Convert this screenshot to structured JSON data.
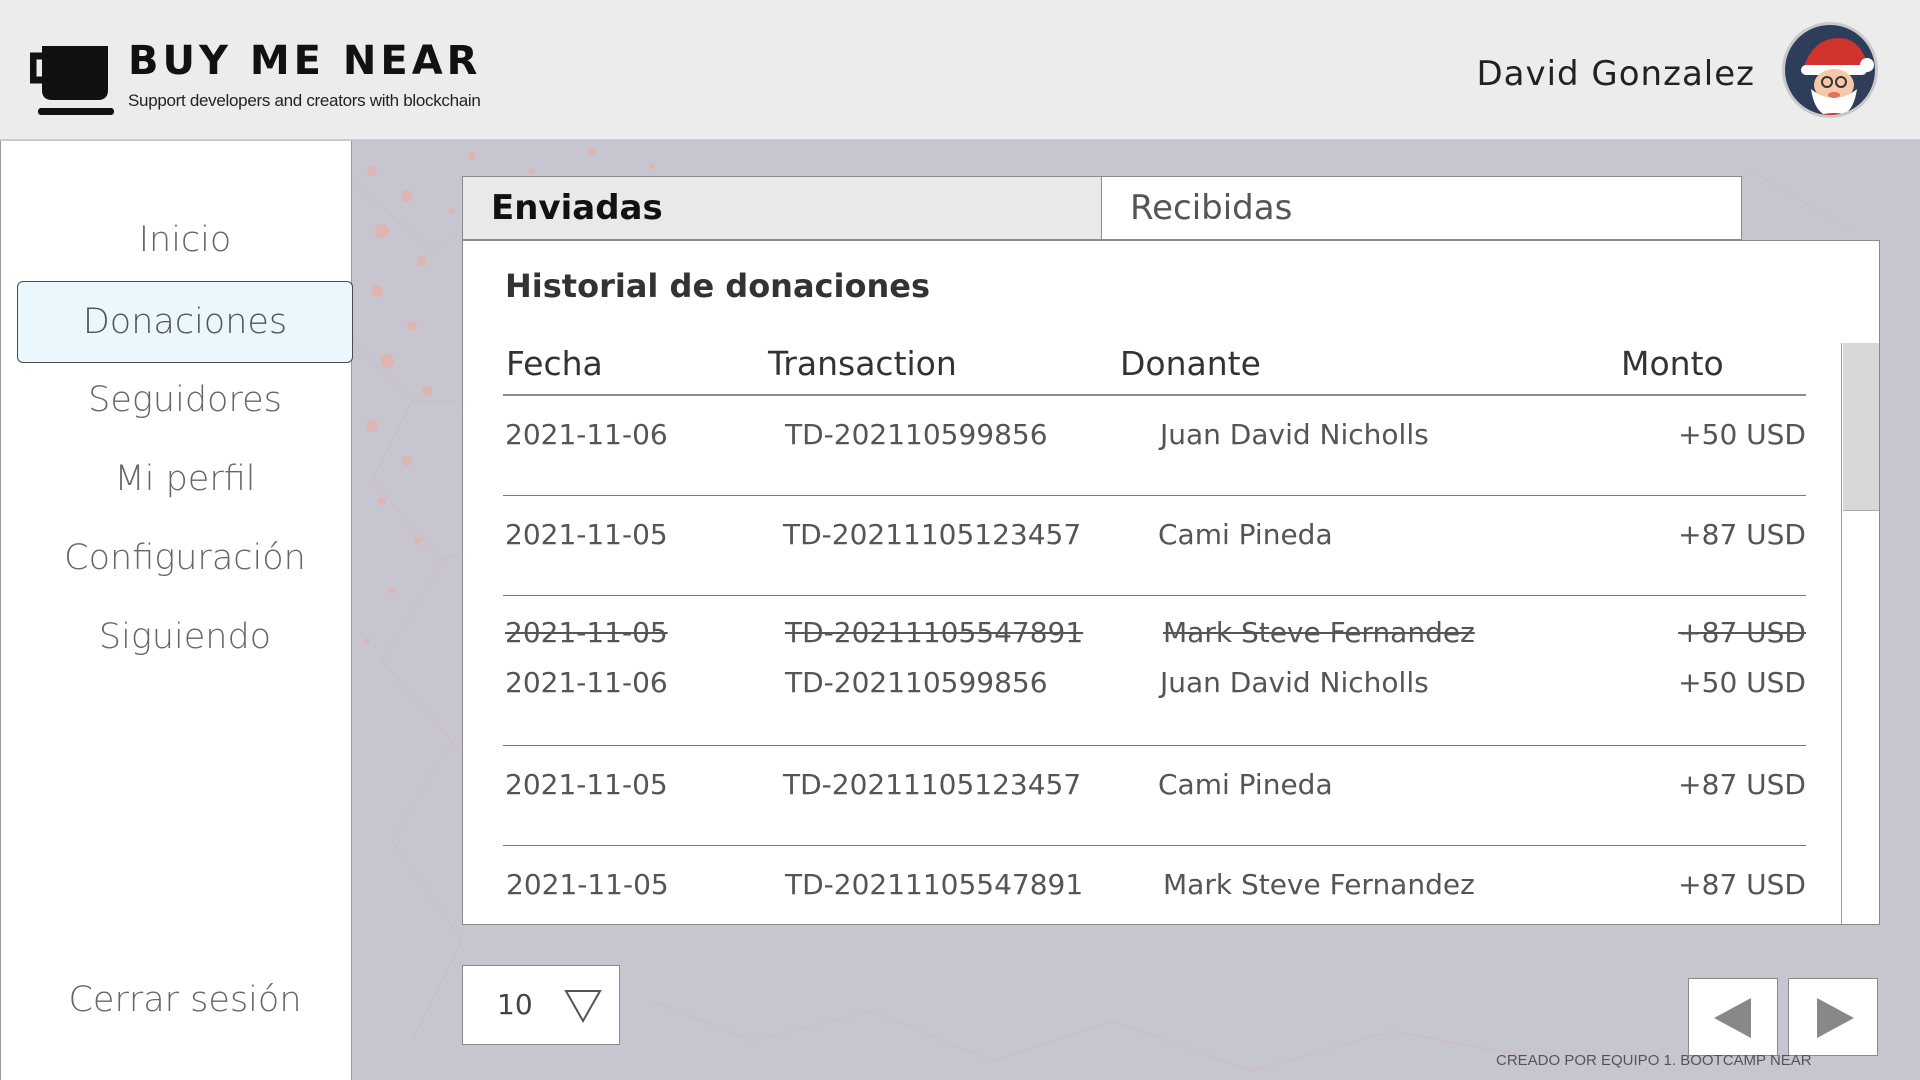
{
  "header": {
    "brand_title": "BUY ME NEAR",
    "brand_subtitle": "Support developers and creators with blockchain",
    "user_name": "David Gonzalez"
  },
  "sidebar": {
    "items": [
      {
        "label": "Inicio",
        "active": false
      },
      {
        "label": "Donaciones",
        "active": true
      },
      {
        "label": "Seguidores",
        "active": false
      },
      {
        "label": "Mi perfil",
        "active": false
      },
      {
        "label": "Configuración",
        "active": false
      },
      {
        "label": "Siguiendo",
        "active": false
      }
    ],
    "logout_label": "Cerrar sesión"
  },
  "tabs": [
    {
      "label": "Enviadas",
      "selected": true
    },
    {
      "label": "Recibidas",
      "selected": false
    }
  ],
  "panel": {
    "title": "Historial de donaciones",
    "columns": [
      "Fecha",
      "Transaction",
      "Donante",
      "Monto"
    ],
    "rows": [
      {
        "fecha": "2021-11-06",
        "transaction": "TD-202110599856",
        "donante": "Juan David Nicholls",
        "monto": "+50 USD"
      },
      {
        "fecha": "2021-11-05",
        "transaction": "TD-20211105123457",
        "donante": "Cami Pineda",
        "monto": "+87 USD"
      },
      {
        "fecha": "2021-11-05",
        "transaction": "TD-20211105547891",
        "donante": "Mark Steve Fernandez",
        "monto": "+87 USD"
      },
      {
        "fecha": "2021-11-06",
        "transaction": "TD-202110599856",
        "donante": "Juan David Nicholls",
        "monto": "+50 USD"
      },
      {
        "fecha": "2021-11-05",
        "transaction": "TD-20211105123457",
        "donante": "Cami Pineda",
        "monto": "+87 USD"
      },
      {
        "fecha": "2021-11-05",
        "transaction": "TD-20211105547891",
        "donante": "Mark Steve Fernandez",
        "monto": "+87 USD"
      }
    ]
  },
  "pagination": {
    "page_size": "10"
  },
  "footer": {
    "credit": "CREADO POR EQUIPO 1. BOOTCAMP NEAR"
  },
  "colors": {
    "active_nav_bg": "#eaf8fd",
    "page_bg": "#c7c6d0",
    "accent_network": "#e8a090",
    "avatar_bg": "#2d3d5a",
    "santa_red": "#d0342c"
  },
  "icons": {
    "logo": "coffee-cup-icon",
    "avatar": "santa-avatar",
    "page_size_arrow": "triangle-down-icon",
    "prev": "triangle-left-icon",
    "next": "triangle-right-icon"
  }
}
